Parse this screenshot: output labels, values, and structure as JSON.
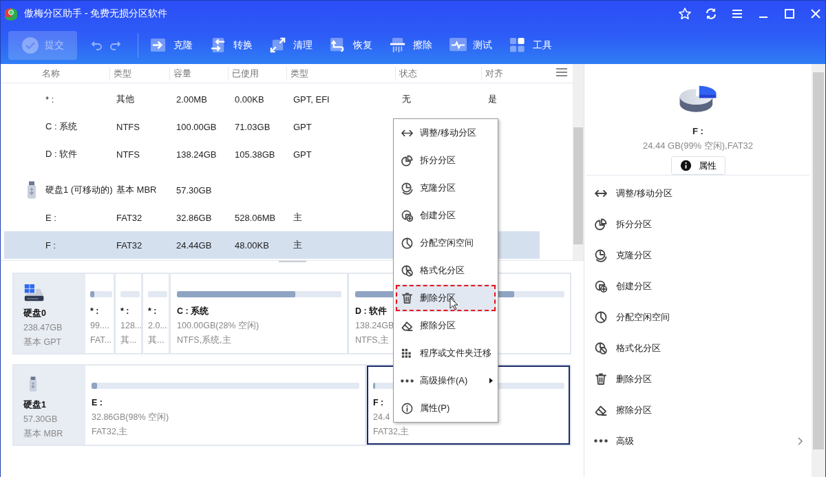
{
  "window": {
    "title": "傲梅分区助手 - 免费无损分区软件"
  },
  "toolbar": {
    "commit": {
      "label": "提交",
      "disabled": true
    },
    "tools": [
      {
        "label": "克隆"
      },
      {
        "label": "转换"
      },
      {
        "label": "清理"
      },
      {
        "label": "恢复"
      },
      {
        "label": "擦除"
      },
      {
        "label": "测试"
      },
      {
        "label": "工具"
      }
    ]
  },
  "table": {
    "columns": [
      "名称",
      "类型",
      "容量",
      "已使用",
      "类型",
      "状态",
      "对齐"
    ],
    "rows": [
      {
        "kind": "partition",
        "name": "* :",
        "type": "其他",
        "capacity": "2.00MB",
        "used": "0.00KB",
        "ptype": "GPT, EFI",
        "status": "无",
        "align": "是",
        "selected": false
      },
      {
        "kind": "partition",
        "name": "C : 系统",
        "type": "NTFS",
        "capacity": "100.00GB",
        "used": "71.03GB",
        "ptype": "GPT",
        "selected": false
      },
      {
        "kind": "partition",
        "name": "D : 软件",
        "type": "NTFS",
        "capacity": "138.24GB",
        "used": "105.38GB",
        "ptype": "GPT",
        "selected": false
      },
      {
        "kind": "disk",
        "name": "硬盘1 (可移动的)",
        "type": "基本 MBR",
        "capacity": "57.30GB"
      },
      {
        "kind": "partition",
        "name": "E :",
        "type": "FAT32",
        "capacity": "32.86GB",
        "used": "528.06MB",
        "ptype": "主",
        "selected": false
      },
      {
        "kind": "partition",
        "name": "F :",
        "type": "FAT32",
        "capacity": "24.44GB",
        "used": "48.00KB",
        "ptype": "主",
        "selected": true
      }
    ]
  },
  "disks": [
    {
      "kind": "system",
      "name": "硬盘0",
      "size": "238.47GB",
      "style": "基本 GPT",
      "partitions": [
        {
          "label": "* :",
          "size": "99....",
          "info": "FAT...",
          "level": 0.2,
          "selected": false
        },
        {
          "label": "* :",
          "size": "128...",
          "info": "其...",
          "selected": false
        },
        {
          "label": "* :",
          "size": "2.0...",
          "info": "其...",
          "selected": false
        },
        {
          "label": "C : 系统",
          "size": "100.00GB(28% 空闲)",
          "info": "NTFS,系统,主",
          "level": 0.72,
          "selected": false
        },
        {
          "label": "D : 软件",
          "size": "138.24GB",
          "info": "NTFS,主",
          "level": 0.76,
          "selected": false
        }
      ]
    },
    {
      "kind": "usb",
      "name": "硬盘1",
      "size": "57.30GB",
      "style": "基本 MBR",
      "partitions": [
        {
          "label": "E :",
          "size": "32.86GB(98% 空闲)",
          "info": "FAT32,主",
          "level": 0.02,
          "selected": false
        },
        {
          "label": "F :",
          "size": "24.4",
          "info": "FAT32,主",
          "level": 0.01,
          "selected": true
        }
      ]
    }
  ],
  "context_menu": {
    "items": [
      {
        "label": "调整/移动分区",
        "selected": false,
        "submenu": false
      },
      {
        "label": "拆分分区",
        "selected": false,
        "submenu": false
      },
      {
        "label": "克隆分区",
        "selected": false,
        "submenu": false
      },
      {
        "label": "创建分区",
        "selected": false,
        "submenu": false
      },
      {
        "label": "分配空闲空间",
        "selected": false,
        "submenu": false
      },
      {
        "label": "格式化分区",
        "selected": false,
        "submenu": false
      },
      {
        "label": "删除分区",
        "selected": true,
        "submenu": false
      },
      {
        "label": "擦除分区",
        "selected": false,
        "submenu": false
      },
      {
        "label": "程序或文件夹迁移",
        "selected": false,
        "submenu": false
      },
      {
        "label": "高级操作(A)",
        "selected": false,
        "submenu": true
      },
      {
        "label": "属性(P)",
        "selected": false,
        "submenu": false
      }
    ]
  },
  "details": {
    "name": "F :",
    "summary": "24.44 GB(99% 空闲),FAT32",
    "properties_button": "属性",
    "actions": [
      {
        "label": "调整/移动分区",
        "submenu": false
      },
      {
        "label": "拆分分区",
        "submenu": false
      },
      {
        "label": "克隆分区",
        "submenu": false
      },
      {
        "label": "创建分区",
        "submenu": false
      },
      {
        "label": "分配空闲空间",
        "submenu": false
      },
      {
        "label": "格式化分区",
        "submenu": false
      },
      {
        "label": "删除分区",
        "submenu": false
      },
      {
        "label": "擦除分区",
        "submenu": false
      },
      {
        "label": "高级",
        "submenu": true
      }
    ]
  }
}
